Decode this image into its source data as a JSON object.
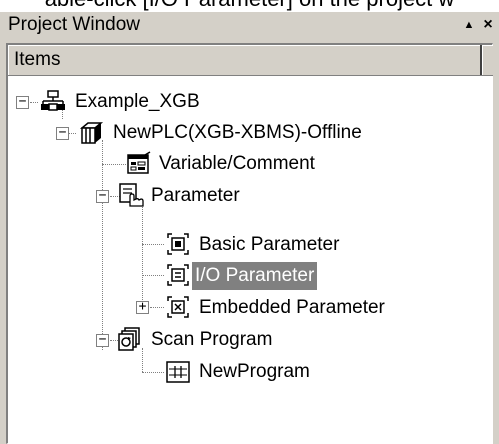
{
  "top_caption": "able-click [I/O Parameter] on the project w",
  "window": {
    "title": "Project Window",
    "pin_glyph": "▲",
    "close_glyph": "×"
  },
  "columns": {
    "items": "Items"
  },
  "tree": {
    "root": {
      "label": "Example_XGB",
      "toggle": "−"
    },
    "plc": {
      "label": "NewPLC(XGB-XBMS)-Offline",
      "toggle": "−"
    },
    "variable": {
      "label": "Variable/Comment"
    },
    "parameter": {
      "label": "Parameter",
      "toggle": "−"
    },
    "basic_param": {
      "label": "Basic Parameter"
    },
    "io_param": {
      "label": "I/O Parameter",
      "selected": true
    },
    "embedded_param": {
      "label": "Embedded Parameter",
      "toggle": "+"
    },
    "scan_program": {
      "label": "Scan Program",
      "toggle": "−"
    },
    "new_program": {
      "label": "NewProgram"
    }
  },
  "colors": {
    "selection": "#808080",
    "panel": "#d4d0c8"
  }
}
